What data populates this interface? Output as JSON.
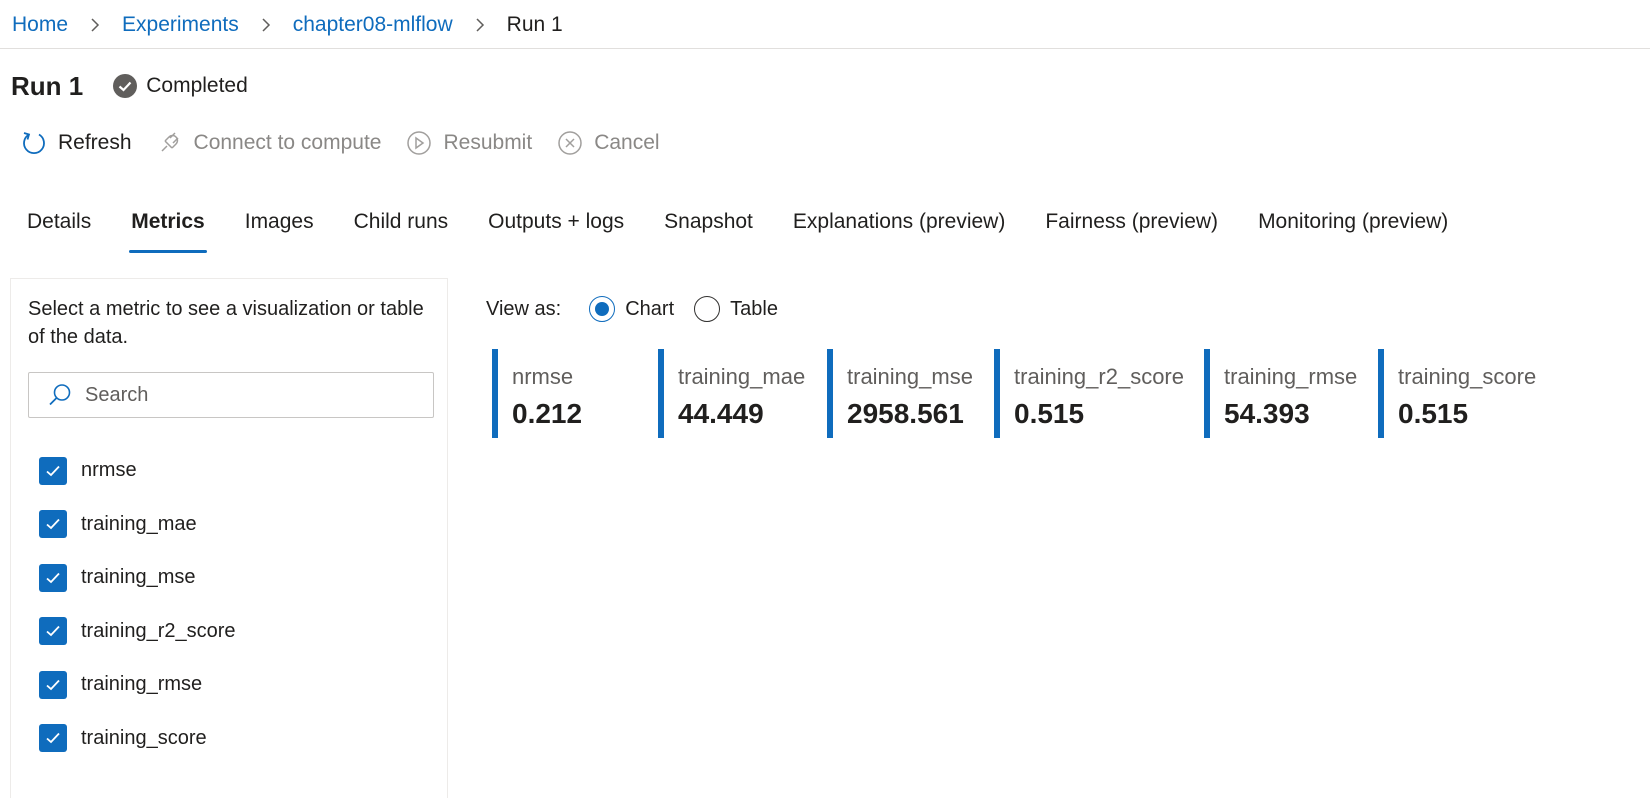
{
  "breadcrumb": [
    {
      "label": "Home",
      "current": false
    },
    {
      "label": "Experiments",
      "current": false
    },
    {
      "label": "chapter08-mlflow",
      "current": false
    },
    {
      "label": "Run 1",
      "current": true
    }
  ],
  "header": {
    "title": "Run 1",
    "status": "Completed",
    "status_icon": "check-circle-icon"
  },
  "toolbar": {
    "refresh": "Refresh",
    "connect": "Connect to compute",
    "resubmit": "Resubmit",
    "cancel": "Cancel"
  },
  "tabs": [
    {
      "label": "Details"
    },
    {
      "label": "Metrics",
      "active": true
    },
    {
      "label": "Images"
    },
    {
      "label": "Child runs"
    },
    {
      "label": "Outputs + logs"
    },
    {
      "label": "Snapshot"
    },
    {
      "label": "Explanations (preview)"
    },
    {
      "label": "Fairness (preview)"
    },
    {
      "label": "Monitoring (preview)"
    }
  ],
  "metrics_panel": {
    "hint": "Select a metric to see a visualization or table of the data.",
    "search_placeholder": "Search",
    "items": [
      {
        "label": "nrmse",
        "checked": true
      },
      {
        "label": "training_mae",
        "checked": true
      },
      {
        "label": "training_mse",
        "checked": true
      },
      {
        "label": "training_r2_score",
        "checked": true
      },
      {
        "label": "training_rmse",
        "checked": true
      },
      {
        "label": "training_score",
        "checked": true
      }
    ]
  },
  "view_as": {
    "label": "View as:",
    "options": [
      {
        "label": "Chart",
        "selected": true
      },
      {
        "label": "Table",
        "selected": false
      }
    ]
  },
  "metric_tiles": [
    {
      "name": "nrmse",
      "value": "0.212"
    },
    {
      "name": "training_mae",
      "value": "44.449"
    },
    {
      "name": "training_mse",
      "value": "2958.561"
    },
    {
      "name": "training_r2_score",
      "value": "0.515"
    },
    {
      "name": "training_rmse",
      "value": "54.393"
    },
    {
      "name": "training_score",
      "value": "0.515"
    }
  ],
  "colors": {
    "accent": "#0f6cbd",
    "status_icon": "#605e5c",
    "disabled_text": "#8a8886"
  }
}
